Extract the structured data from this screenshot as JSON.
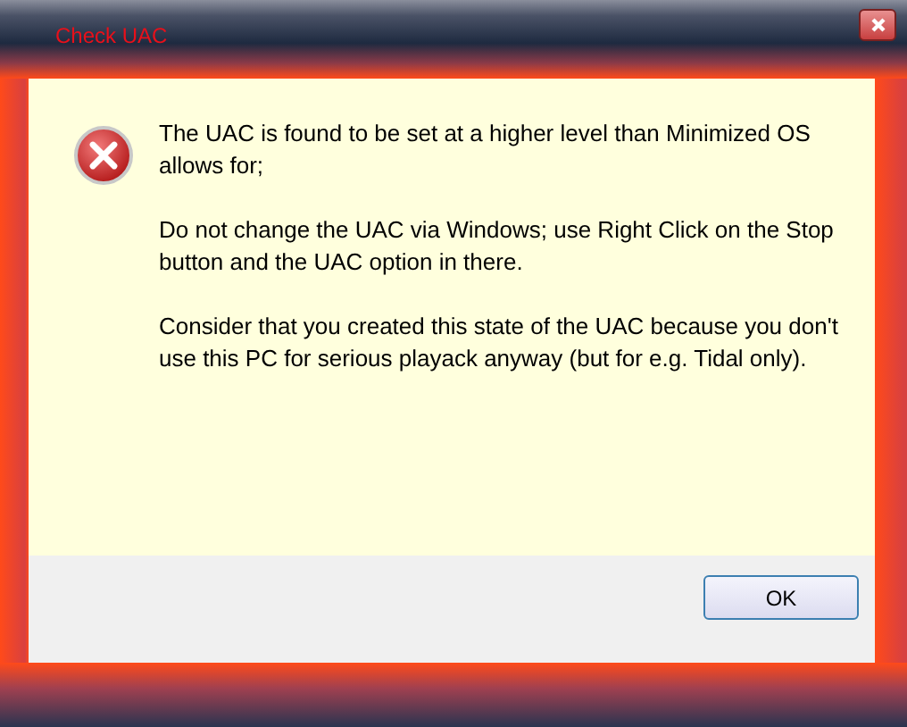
{
  "window": {
    "title": "Check UAC"
  },
  "message": {
    "kind": "error",
    "paragraphs": [
      "The UAC is found to be set at a higher level than Minimized OS allows for;",
      "Do not change the UAC via Windows; use Right Click on the Stop button and the UAC option in there.",
      "Consider that you created this state of the UAC because you don't use this PC for serious playack anyway (but for e.g. Tidal only)."
    ]
  },
  "buttons": [
    "OK"
  ]
}
